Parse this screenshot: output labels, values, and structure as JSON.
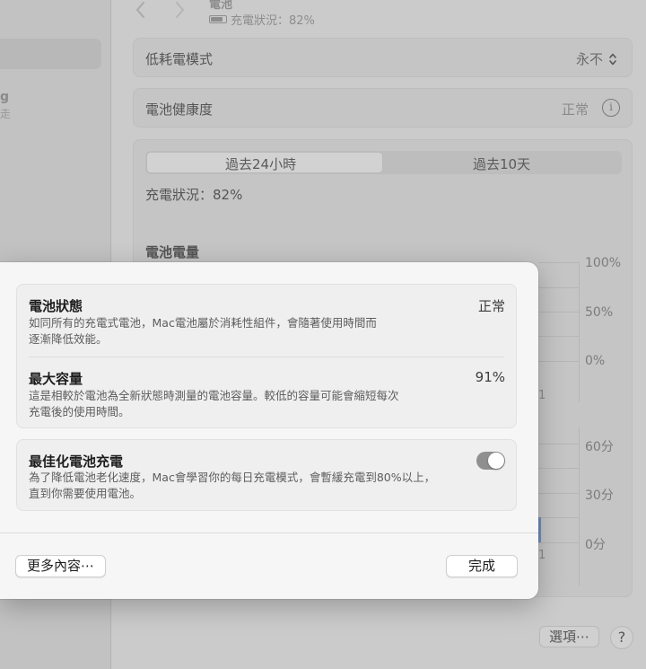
{
  "sidebar": {
    "item_fragment_1": "g",
    "item_fragment_2": "走"
  },
  "header": {
    "back_icon": "chevron-left-icon",
    "forward_icon": "chevron-right-icon",
    "title": "電池",
    "status": "充電狀況：82%"
  },
  "settings": {
    "low_power_label": "低耗電模式",
    "low_power_value": "永不",
    "battery_health_label": "電池健康度",
    "battery_health_value": "正常"
  },
  "history": {
    "tabs": [
      {
        "label": "過去24小時",
        "selected": true
      },
      {
        "label": "過去10天",
        "selected": false
      }
    ],
    "charge_status": "充電狀況：82%",
    "battery_level_heading": "電池電量",
    "level_axis": [
      "100%",
      "50%",
      "0%"
    ],
    "level_fragment": "1",
    "usage_axis": [
      "60分",
      "30分",
      "0分"
    ],
    "usage_fragment": "1"
  },
  "footer": {
    "options_label": "選項⋯",
    "help_label": "?"
  },
  "dialog": {
    "battery_condition": {
      "title": "電池狀態",
      "value": "正常",
      "description_line1": "如同所有的充電式電池，Mac電池屬於消耗性組件，會隨著使用時間而",
      "description_line2": "逐漸降低效能。"
    },
    "max_capacity": {
      "title": "最大容量",
      "value": "91%",
      "description_line1": "這是相較於電池為全新狀態時測量的電池容量。較低的容量可能會縮短每次",
      "description_line2": "充電後的使用時間。"
    },
    "optimized_charging": {
      "title": "最佳化電池充電",
      "enabled": true,
      "description_line1": "為了降低電池老化速度，Mac會學習你的每日充電模式，會暫緩充電到80%以上，",
      "description_line2": "直到你需要使用電池。"
    },
    "more_info_label": "更多內容⋯",
    "done_label": "完成"
  }
}
